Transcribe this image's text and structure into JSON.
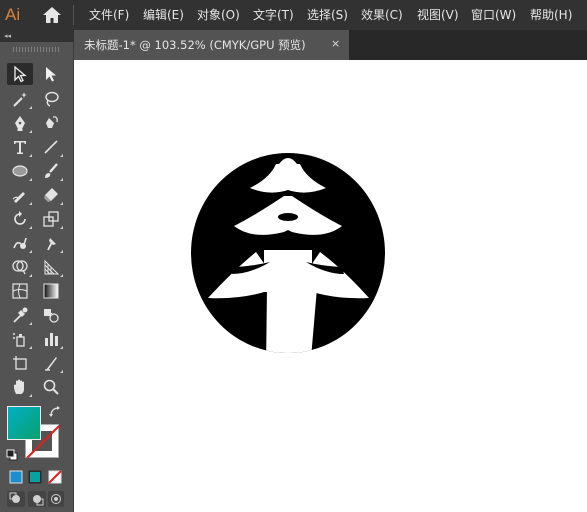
{
  "app": {
    "logo_text": "Ai",
    "accent_color": "#d9813b"
  },
  "menu": {
    "items": [
      "文件(F)",
      "编辑(E)",
      "对象(O)",
      "文字(T)",
      "选择(S)",
      "效果(C)",
      "视图(V)",
      "窗口(W)",
      "帮助(H)"
    ]
  },
  "document_tab": {
    "title": "未标题-1* @ 103.52% (CMYK/GPU 预览)",
    "close_glyph": "×"
  },
  "panel": {
    "collapse_glyph": "◂◂"
  },
  "toolbar": {
    "tools": [
      "selection-tool",
      "direct-selection-tool",
      "magic-wand-tool",
      "lasso-tool",
      "pen-tool",
      "curvature-tool",
      "type-tool",
      "line-segment-tool",
      "ellipse-tool",
      "paintbrush-tool",
      "shaper-tool",
      "eraser-tool",
      "rotate-tool",
      "scale-tool",
      "warp-tool",
      "puppet-warp-tool",
      "shape-builder-tool",
      "perspective-grid-tool",
      "mesh-tool",
      "gradient-tool",
      "eyedropper-tool",
      "blend-tool",
      "symbol-sprayer-tool",
      "column-graph-tool",
      "artboard-tool",
      "slice-tool",
      "hand-tool",
      "zoom-tool"
    ],
    "fill_color_start": "#00b0c8",
    "fill_color_end": "#0aa06a",
    "stroke_color": "none"
  },
  "canvas": {
    "background": "#ffffff",
    "artwork_color": "#000000",
    "artwork_description_icon": "tree-in-circle-logo"
  }
}
